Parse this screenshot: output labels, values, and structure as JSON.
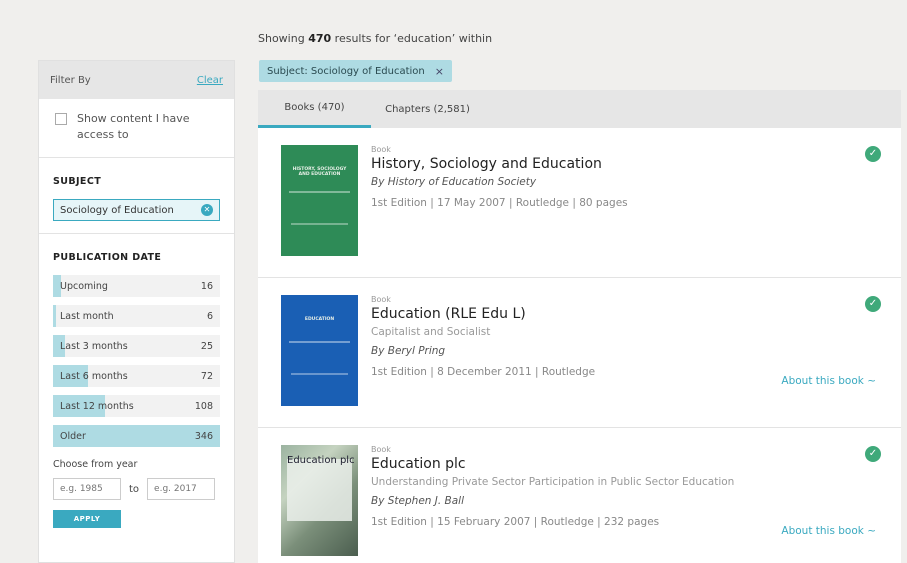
{
  "header": {
    "prefix": "Showing",
    "count": "470",
    "suffix": "results for ‘education’ within"
  },
  "chip": {
    "label": "Subject: Sociology of Education",
    "close": "×"
  },
  "sidebar": {
    "filter_by": "Filter By",
    "clear": "Clear",
    "access_label": "Show content I have access to",
    "subject_title": "SUBJECT",
    "subject_value": "Sociology of Education",
    "subject_clear_glyph": "✕",
    "pub_date_title": "PUBLICATION DATE",
    "date_ranges": [
      {
        "label": "Upcoming",
        "count": "16",
        "fill": 0.046
      },
      {
        "label": "Last month",
        "count": "6",
        "fill": 0.017
      },
      {
        "label": "Last 3 months",
        "count": "25",
        "fill": 0.072
      },
      {
        "label": "Last 6 months",
        "count": "72",
        "fill": 0.208
      },
      {
        "label": "Last 12 months",
        "count": "108",
        "fill": 0.312
      },
      {
        "label": "Older",
        "count": "346",
        "fill": 1.0
      }
    ],
    "year_label": "Choose from year",
    "from_placeholder": "e.g. 1985",
    "to_label": "to",
    "to_placeholder": "e.g. 2017",
    "apply_label": "APPLY"
  },
  "tabs": [
    {
      "label": "Books (470)",
      "active": true
    },
    {
      "label": "Chapters (2,581)",
      "active": false
    }
  ],
  "results": [
    {
      "type": "Book",
      "title": "History, Sociology and Education",
      "subtitle": "",
      "author": "By History of Education Society",
      "details": "1st Edition | 17 May 2007 | Routledge | 80 pages",
      "about": "",
      "cover_text": "HISTORY, SOCIOLOGY AND EDUCATION"
    },
    {
      "type": "Book",
      "title": "Education (RLE Edu L)",
      "subtitle": "Capitalist and Socialist",
      "author": "By Beryl Pring",
      "details": "1st Edition | 8 December 2011 | Routledge",
      "about": "About this book ~",
      "cover_text": "EDUCATION"
    },
    {
      "type": "Book",
      "title": "Education plc",
      "subtitle": "Understanding Private Sector Participation in Public Sector Education",
      "author": "By Stephen J. Ball",
      "details": "1st Edition | 15 February 2007 | Routledge | 232 pages",
      "about": "About this book ~",
      "cover_text": "Education plc"
    }
  ],
  "icons": {
    "check": "✓",
    "colors": {
      "accent": "#3aa9c0",
      "check": "#3fa97a",
      "chip": "#aedbe3"
    }
  }
}
